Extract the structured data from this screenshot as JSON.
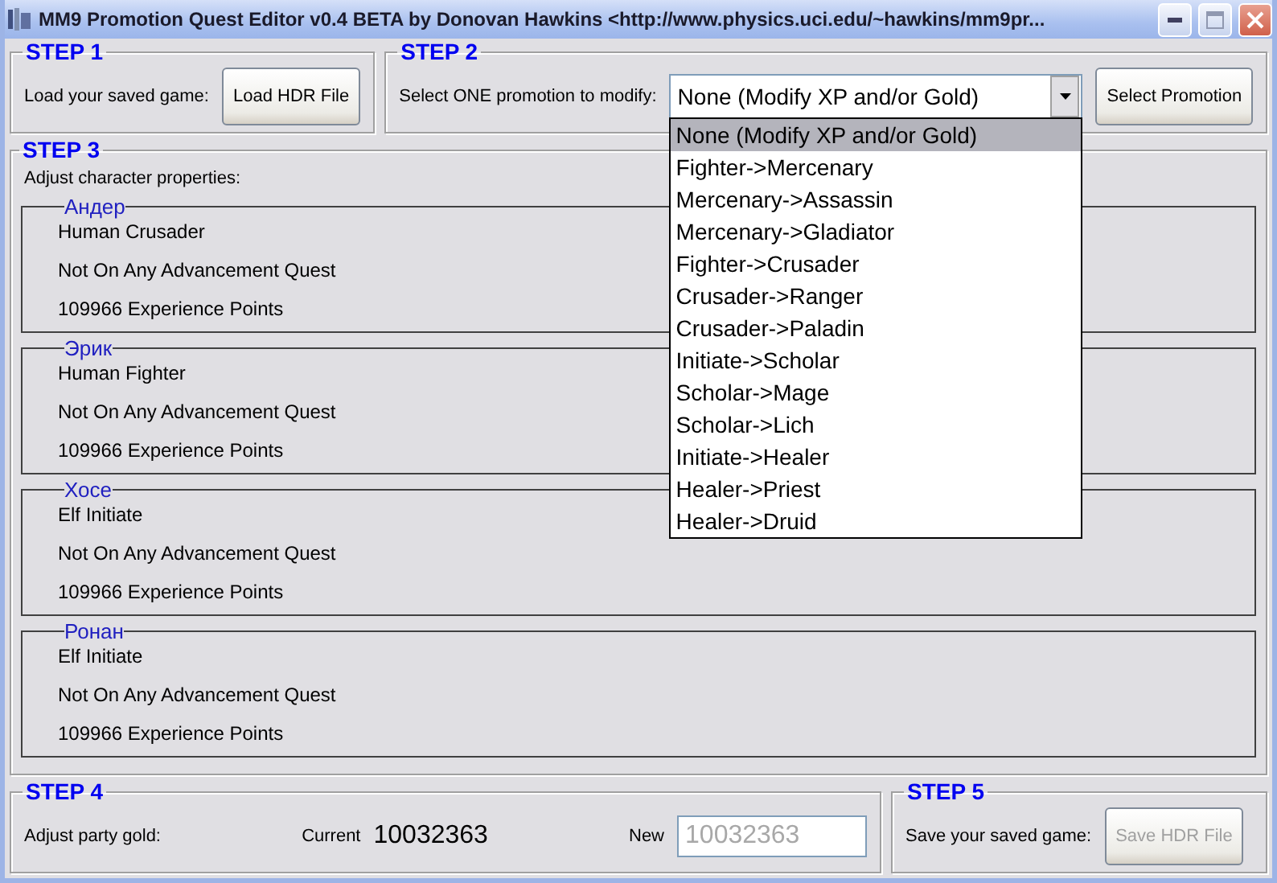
{
  "window": {
    "title": "MM9 Promotion Quest Editor v0.4 BETA by Donovan Hawkins <http://www.physics.uci.edu/~hawkins/mm9pr..."
  },
  "step1": {
    "legend": "STEP 1",
    "label": "Load your saved game:",
    "button": "Load HDR File"
  },
  "step2": {
    "legend": "STEP 2",
    "label": "Select ONE promotion to modify:",
    "combo": {
      "value": "None (Modify XP and/or Gold)",
      "expanded": true
    },
    "button": "Select Promotion",
    "options": [
      {
        "label": "None (Modify XP and/or Gold)",
        "selected": true
      },
      {
        "label": "Fighter->Mercenary",
        "selected": false
      },
      {
        "label": "Mercenary->Assassin",
        "selected": false
      },
      {
        "label": "Mercenary->Gladiator",
        "selected": false
      },
      {
        "label": "Fighter->Crusader",
        "selected": false
      },
      {
        "label": "Crusader->Ranger",
        "selected": false
      },
      {
        "label": "Crusader->Paladin",
        "selected": false
      },
      {
        "label": "Initiate->Scholar",
        "selected": false
      },
      {
        "label": "Scholar->Mage",
        "selected": false
      },
      {
        "label": "Scholar->Lich",
        "selected": false
      },
      {
        "label": "Initiate->Healer",
        "selected": false
      },
      {
        "label": "Healer->Priest",
        "selected": false
      },
      {
        "label": "Healer->Druid",
        "selected": false
      }
    ]
  },
  "step3": {
    "legend": "STEP 3",
    "label": "Adjust character properties:",
    "characters": [
      {
        "name": "Андер",
        "race_class": "Human Crusader",
        "quest": "Not On Any Advancement Quest",
        "experience": "109966 Experience Points"
      },
      {
        "name": "Эрик",
        "race_class": "Human Fighter",
        "quest": "Not On Any Advancement Quest",
        "experience": "109966 Experience Points"
      },
      {
        "name": "Хосе",
        "race_class": "Elf Initiate",
        "quest": "Not On Any Advancement Quest",
        "experience": "109966 Experience Points"
      },
      {
        "name": "Ронан",
        "race_class": "Elf Initiate",
        "quest": "Not On Any Advancement Quest",
        "experience": "109966 Experience Points"
      }
    ]
  },
  "step4": {
    "legend": "STEP 4",
    "label": "Adjust party gold:",
    "current_label": "Current",
    "current_value": "10032363",
    "new_label": "New",
    "new_field": {
      "value": "10032363",
      "disabled": true
    }
  },
  "step5": {
    "legend": "STEP 5",
    "label": "Save your saved game:",
    "button": {
      "label": "Save HDR File",
      "disabled": true
    }
  }
}
